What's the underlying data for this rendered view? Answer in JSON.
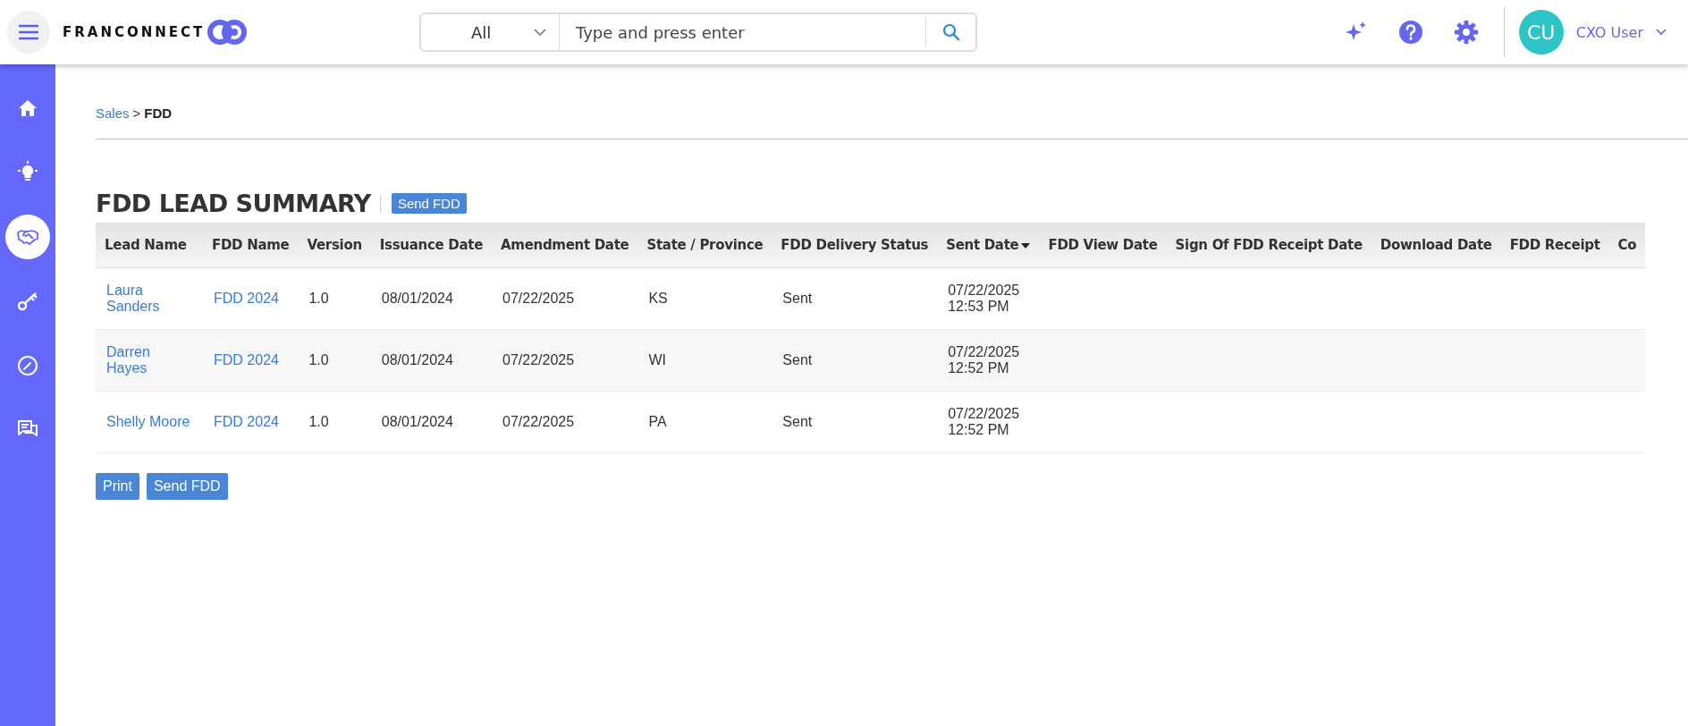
{
  "header": {
    "logo": "FRANCONNECT",
    "search": {
      "scope": "All",
      "placeholder": "Type and press enter"
    },
    "user": {
      "initials": "CU",
      "name": "CXO User"
    }
  },
  "sidebar": {
    "items": [
      {
        "kind": "home",
        "selected": false
      },
      {
        "kind": "idea",
        "selected": false
      },
      {
        "kind": "handshake",
        "selected": true
      },
      {
        "kind": "key",
        "selected": false
      },
      {
        "kind": "gauge",
        "selected": false
      },
      {
        "kind": "chat",
        "selected": false
      }
    ]
  },
  "breadcrumb": {
    "link": "Sales",
    "separator": ">",
    "current": "FDD"
  },
  "page_title": "FDD LEAD SUMMARY",
  "title_button": "Send FDD",
  "table": {
    "columns": [
      {
        "label": "Lead Name",
        "sorted": false
      },
      {
        "label": "FDD Name",
        "sorted": false
      },
      {
        "label": "Version",
        "sorted": false
      },
      {
        "label": "Issuance Date",
        "sorted": false
      },
      {
        "label": "Amendment Date",
        "sorted": false
      },
      {
        "label": "State / Province",
        "sorted": false
      },
      {
        "label": "FDD Delivery Status",
        "sorted": false
      },
      {
        "label": "Sent Date",
        "sorted": true
      },
      {
        "label": "FDD View Date",
        "sorted": false
      },
      {
        "label": "Sign Of FDD Receipt Date",
        "sorted": false
      },
      {
        "label": "Download Date",
        "sorted": false
      },
      {
        "label": "FDD Receipt",
        "sorted": false
      },
      {
        "label": "Co",
        "sorted": false
      }
    ],
    "rows": [
      {
        "lead_name": "Laura Sanders",
        "fdd_name": "FDD 2024",
        "version": "1.0",
        "issuance_date": "08/01/2024",
        "amendment_date": "07/22/2025",
        "state": "KS",
        "status": "Sent",
        "sent_date": "07/22/2025",
        "sent_time": "12:53 PM"
      },
      {
        "lead_name": "Darren Hayes",
        "fdd_name": "FDD 2024",
        "version": "1.0",
        "issuance_date": "08/01/2024",
        "amendment_date": "07/22/2025",
        "state": "WI",
        "status": "Sent",
        "sent_date": "07/22/2025",
        "sent_time": "12:52 PM"
      },
      {
        "lead_name": "Shelly Moore",
        "fdd_name": "FDD 2024",
        "version": "1.0",
        "issuance_date": "08/01/2024",
        "amendment_date": "07/22/2025",
        "state": "PA",
        "status": "Sent",
        "sent_date": "07/22/2025",
        "sent_time": "12:52 PM"
      }
    ]
  },
  "footer_buttons": [
    "Print",
    "Send FDD"
  ]
}
